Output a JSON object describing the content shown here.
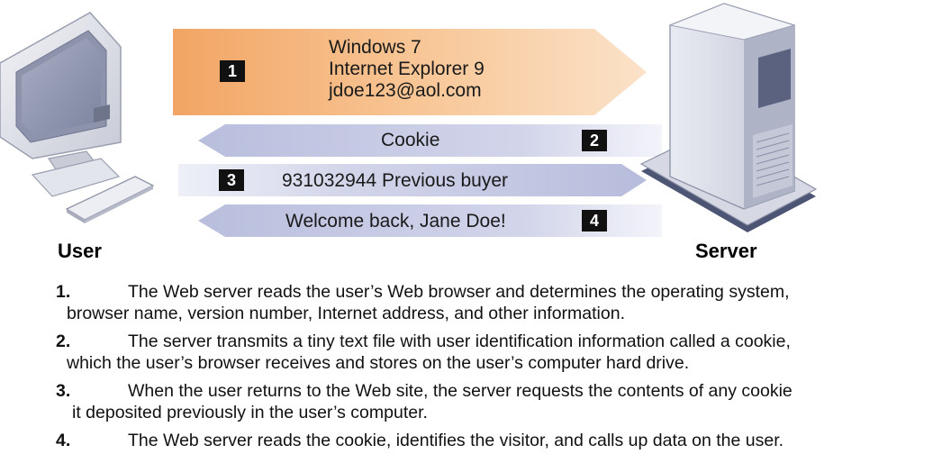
{
  "colors": {
    "arrow_orange": "#f5b57a",
    "arrow_blue": "#c9cde6",
    "server_body": "#dcdfe9",
    "server_dark": "#5c6480"
  },
  "labels": {
    "user": "User",
    "server": "Server"
  },
  "icons": {
    "user_device": "desktop-computer-icon",
    "server_device": "tower-server-icon"
  },
  "arrows": [
    {
      "num": "1",
      "lines": [
        "Windows 7",
        "Internet Explorer 9",
        "jdoe123@aol.com"
      ],
      "direction": "to-server"
    },
    {
      "num": "2",
      "text": "Cookie",
      "direction": "to-user"
    },
    {
      "num": "3",
      "text": "931032944 Previous buyer",
      "direction": "to-server"
    },
    {
      "num": "4",
      "text": "Welcome back, Jane Doe!",
      "direction": "to-user"
    }
  ],
  "steps": [
    {
      "num": "1.",
      "text": "The Web server reads the user’s Web browser and determines the operating system,",
      "cont": "browser name, version number, Internet address, and other information."
    },
    {
      "num": "2.",
      "text": "The server transmits a tiny text file with user identification information called a cookie,",
      "cont": "which the user’s browser receives and stores on the user’s computer hard drive."
    },
    {
      "num": "3.",
      "text": "When the user returns to the Web site, the server requests the contents of any cookie",
      "cont": "it deposited previously in the user’s computer."
    },
    {
      "num": "4.",
      "text": "The Web server reads the cookie, identifies the visitor, and calls up data on the user.",
      "cont": ""
    }
  ]
}
